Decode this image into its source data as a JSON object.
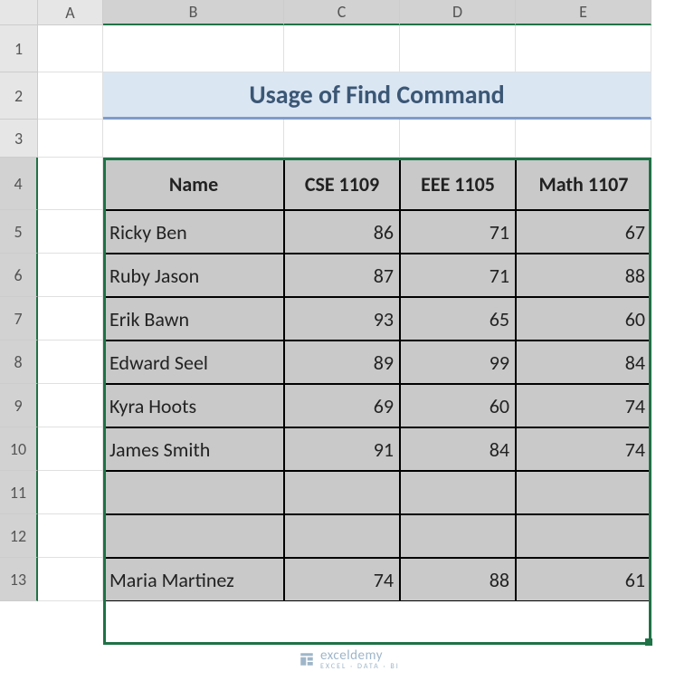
{
  "columns": [
    "A",
    "B",
    "C",
    "D",
    "E"
  ],
  "rows": [
    "1",
    "2",
    "3",
    "4",
    "5",
    "6",
    "7",
    "8",
    "9",
    "10",
    "11",
    "12",
    "13"
  ],
  "title": "Usage of Find Command",
  "table": {
    "headers": [
      "Name",
      "CSE 1109",
      "EEE 1105",
      "Math 1107"
    ],
    "data": [
      {
        "name": "Ricky Ben",
        "c": "86",
        "d": "71",
        "e": "67"
      },
      {
        "name": "Ruby Jason",
        "c": "87",
        "d": "71",
        "e": "88"
      },
      {
        "name": "Erik Bawn",
        "c": "93",
        "d": "65",
        "e": "60"
      },
      {
        "name": "Edward Seel",
        "c": "89",
        "d": "99",
        "e": "84"
      },
      {
        "name": "Kyra Hoots",
        "c": "69",
        "d": "60",
        "e": "74"
      },
      {
        "name": "James Smith",
        "c": "91",
        "d": "84",
        "e": "74"
      },
      {
        "name": "",
        "c": "",
        "d": "",
        "e": ""
      },
      {
        "name": "",
        "c": "",
        "d": "",
        "e": ""
      },
      {
        "name": "Maria Martinez",
        "c": "74",
        "d": "88",
        "e": "61"
      }
    ]
  },
  "watermark": {
    "brand": "exceldemy",
    "sub": "EXCEL · DATA · BI"
  },
  "chart_data": {
    "type": "table",
    "title": "Usage of Find Command",
    "columns": [
      "Name",
      "CSE 1109",
      "EEE 1105",
      "Math 1107"
    ],
    "rows": [
      [
        "Ricky Ben",
        86,
        71,
        67
      ],
      [
        "Ruby Jason",
        87,
        71,
        88
      ],
      [
        "Erik Bawn",
        93,
        65,
        60
      ],
      [
        "Edward Seel",
        89,
        99,
        84
      ],
      [
        "Kyra Hoots",
        69,
        60,
        74
      ],
      [
        "James Smith",
        91,
        84,
        74
      ],
      [
        "",
        null,
        null,
        null
      ],
      [
        "",
        null,
        null,
        null
      ],
      [
        "Maria Martinez",
        74,
        88,
        61
      ]
    ]
  }
}
